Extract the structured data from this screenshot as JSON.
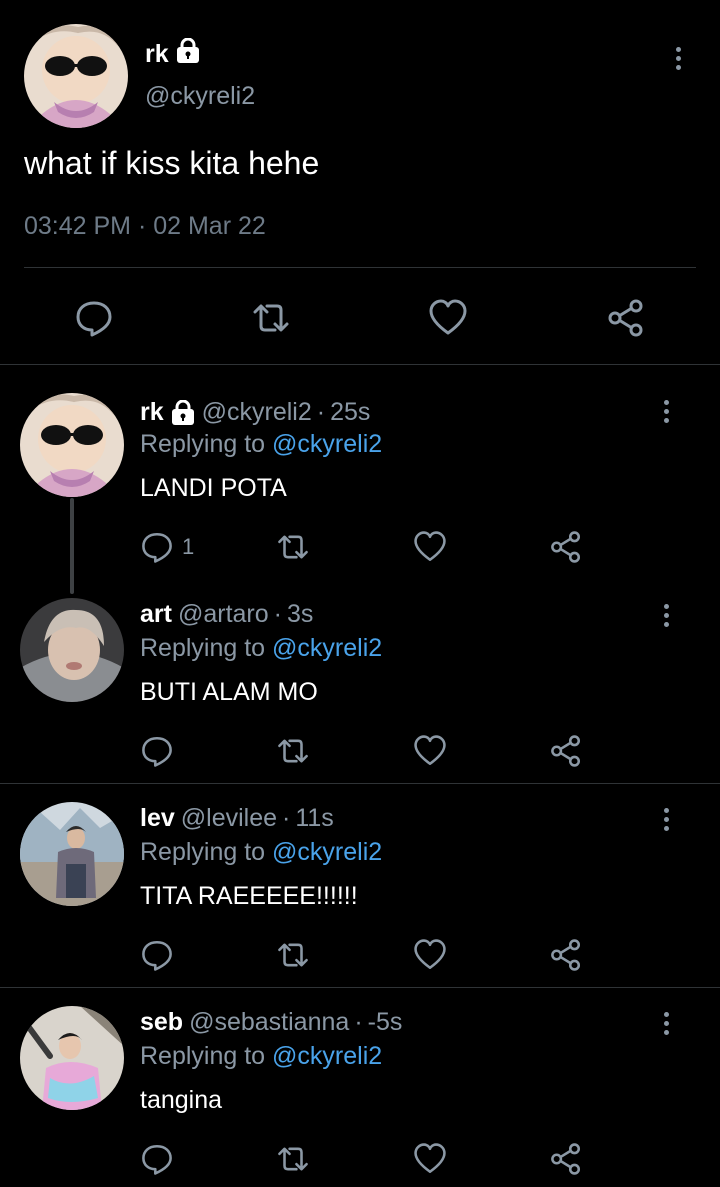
{
  "colors": {
    "background": "#000000",
    "muted": "#8b98a5",
    "link": "#4aa3ea",
    "divider": "#2f3336"
  },
  "main_tweet": {
    "display_name": "rk",
    "locked_icon": "lock-icon",
    "handle": "@ckyreli2",
    "text": "what if kiss kita hehe",
    "timestamp": "03:42 PM · 02 Mar 22",
    "actions": [
      "reply-icon",
      "retweet-icon",
      "like-icon",
      "share-icon"
    ]
  },
  "replies": [
    {
      "name": "rk",
      "locked": true,
      "handle": "@ckyreli2",
      "time": "25s",
      "replying_prefix": "Replying to",
      "replying_to": "@ckyreli2",
      "text": "LANDI POTA",
      "reply_count": "1"
    },
    {
      "name": "art",
      "locked": false,
      "handle": "@artaro",
      "time": "3s",
      "replying_prefix": "Replying to",
      "replying_to": "@ckyreli2",
      "text": "BUTI ALAM MO",
      "reply_count": ""
    },
    {
      "name": "lev",
      "locked": false,
      "handle": "@levilee",
      "time": "11s",
      "replying_prefix": "Replying to",
      "replying_to": "@ckyreli2",
      "text": "TITA RAEEEEE!!!!!!",
      "reply_count": ""
    },
    {
      "name": "seb",
      "locked": false,
      "handle": "@sebastianna",
      "time": "-5s",
      "replying_prefix": "Replying to",
      "replying_to": "@ckyreli2",
      "text": "tangina",
      "reply_count": ""
    }
  ],
  "separator": "·"
}
